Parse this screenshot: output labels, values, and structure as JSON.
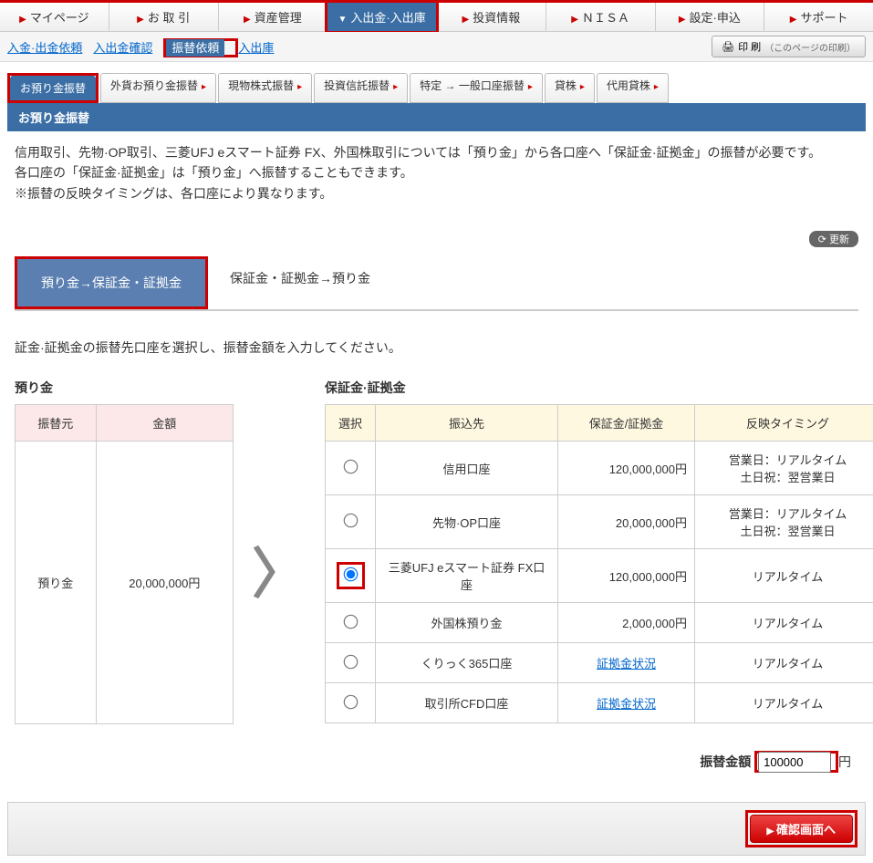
{
  "topnav": [
    {
      "label": "マイページ",
      "active": false
    },
    {
      "label": "お 取 引",
      "active": false
    },
    {
      "label": "資産管理",
      "active": false
    },
    {
      "label": "入出金·入出庫",
      "active": true
    },
    {
      "label": "投資情報",
      "active": false
    },
    {
      "label": "ＮＩＳＡ",
      "active": false
    },
    {
      "label": "設定·申込",
      "active": false
    },
    {
      "label": "サポート",
      "active": false
    }
  ],
  "subnav": {
    "items": [
      "入金·出金依頼",
      "入出金確認",
      "振替依頼",
      "入出庫"
    ],
    "active_index": 2,
    "print_label": "印 刷",
    "print_hint": "（このページの印刷）"
  },
  "tabs": [
    {
      "label": "お預り金振替",
      "active": true
    },
    {
      "label": "外貨お預り金振替",
      "active": false
    },
    {
      "label": "現物株式振替",
      "active": false
    },
    {
      "label": "投資信託振替",
      "active": false
    },
    {
      "label": "特定 → 一般口座振替",
      "active": false
    },
    {
      "label": "貸株",
      "active": false
    },
    {
      "label": "代用貸株",
      "active": false
    }
  ],
  "section_title": "お預り金振替",
  "description": [
    "信用取引、先物·OP取引、三菱UFJ eスマート証券 FX、外国株取引については「預り金」から各口座へ「保証金·証拠金」の振替が必要です。",
    "各口座の「保証金·証拠金」は「預り金」へ振替することもできます。",
    "※振替の反映タイミングは、各口座により異なります。"
  ],
  "update_label": "更新",
  "direction_tabs": [
    {
      "label": "預り金→保証金・証拠金",
      "active": true
    },
    {
      "label": "保証金・証拠金→預り金",
      "active": false
    }
  ],
  "instruction": "証金·証拠金の振替先口座を選択し、振替金額を入力してください。",
  "left_table": {
    "title": "預り金",
    "headers": [
      "振替元",
      "金額"
    ],
    "row": {
      "src": "預り金",
      "amount": "20,000,000円"
    }
  },
  "right_table": {
    "title": "保証金·証拠金",
    "headers": [
      "選択",
      "振込先",
      "保証金/証拠金",
      "反映タイミング"
    ],
    "rows": [
      {
        "dest": "信用口座",
        "amount": "120,000,000円",
        "timing": "営業日：リアルタイム\n土日祝：翌営業日",
        "selected": false,
        "link": false
      },
      {
        "dest": "先物·OP口座",
        "amount": "20,000,000円",
        "timing": "営業日：リアルタイム\n土日祝：翌営業日",
        "selected": false,
        "link": false
      },
      {
        "dest": "三菱UFJ eスマート証券 FX口座",
        "amount": "120,000,000円",
        "timing": "リアルタイム",
        "selected": true,
        "link": false
      },
      {
        "dest": "外国株預り金",
        "amount": "2,000,000円",
        "timing": "リアルタイム",
        "selected": false,
        "link": false
      },
      {
        "dest": "くりっく365口座",
        "amount": "証拠金状況",
        "timing": "リアルタイム",
        "selected": false,
        "link": true
      },
      {
        "dest": "取引所CFD口座",
        "amount": "証拠金状況",
        "timing": "リアルタイム",
        "selected": false,
        "link": true
      }
    ]
  },
  "transfer_amount": {
    "label": "振替金額",
    "value": "100000",
    "unit": "円"
  },
  "confirm_label": "確認画面へ"
}
